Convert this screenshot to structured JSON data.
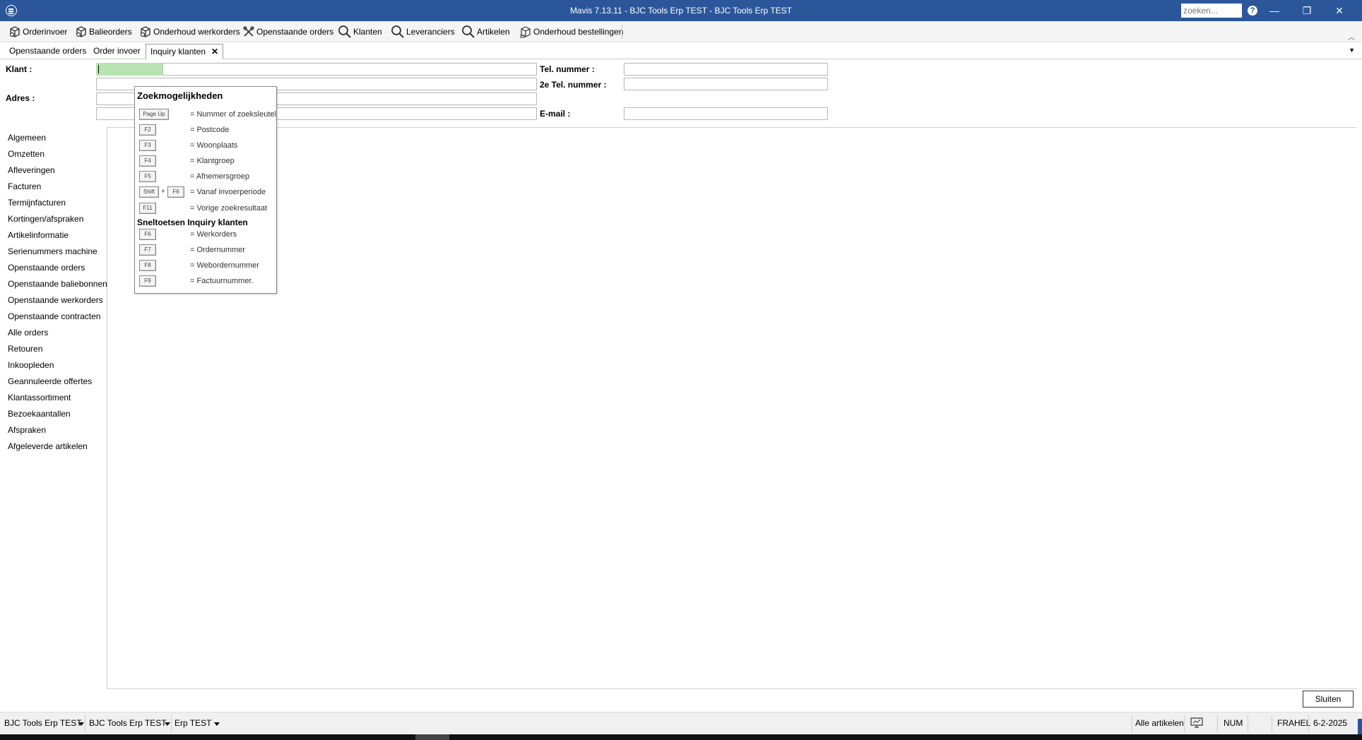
{
  "window": {
    "title": "Mavis 7.13.11 - BJC Tools Erp TEST - BJC Tools Erp TEST",
    "search_placeholder": "zoeken...",
    "help": "?",
    "minimize": "—",
    "restore": "❐",
    "close": "✕"
  },
  "toolbar": {
    "items": [
      {
        "label": "Orderinvoer",
        "icon": "order-entry-icon"
      },
      {
        "label": "Balieorders",
        "icon": "counter-orders-icon"
      },
      {
        "label": "Onderhoud werkorders",
        "icon": "work-orders-icon"
      },
      {
        "label": "Openstaande orders",
        "icon": "tools-icon"
      },
      {
        "label": "Klanten",
        "icon": "search-icon"
      },
      {
        "label": "Leveranciers",
        "icon": "search-icon"
      },
      {
        "label": "Artikelen",
        "icon": "search-icon"
      },
      {
        "label": "Onderhoud bestellingen",
        "icon": "purchase-orders-icon"
      }
    ]
  },
  "tabs": [
    {
      "label": "Openstaande orders"
    },
    {
      "label": "Order invoer"
    },
    {
      "label": "Inquiry klanten",
      "active": true,
      "close": "✕"
    }
  ],
  "form": {
    "klant_label": "Klant :",
    "adres_label": "Adres :",
    "tel_label": "Tel. nummer :",
    "tel2_label": "2e Tel. nummer :",
    "email_label": "E-mail :",
    "klant_value": "",
    "tel_value": "",
    "tel2_value": "",
    "email_value": ""
  },
  "nav": {
    "items": [
      "Algemeen",
      "Omzetten",
      "Afleveringen",
      "Facturen",
      "Termijnfacturen",
      "Kortingen/afspraken",
      "Artikelinformatie",
      "Serienummers machine",
      "Openstaande orders",
      "Openstaande baliebonnen",
      "Openstaande werkorders",
      "Openstaande contracten",
      "Alle orders",
      "Retouren",
      "Inkoopleden",
      "Geannuleerde offertes",
      "Klantassortiment",
      "Bezoekaantallen",
      "Afspraken",
      "Afgeleverde artikelen"
    ]
  },
  "popup": {
    "heading1": "Zoekmogelijkheden",
    "heading2": "Sneltoetsen Inquiry klanten",
    "search_keys": [
      {
        "keys": [
          "Page Up"
        ],
        "desc": "= Nummer of zoeksleutel"
      },
      {
        "keys": [
          "F2"
        ],
        "desc": "= Postcode"
      },
      {
        "keys": [
          "F3"
        ],
        "desc": "= Woonplaats"
      },
      {
        "keys": [
          "F4"
        ],
        "desc": "= Klantgroep"
      },
      {
        "keys": [
          "F5"
        ],
        "desc": "= Afnemersgroep"
      },
      {
        "keys": [
          "Shift",
          "F6"
        ],
        "desc": "= Vanaf invoerperiode",
        "plus": "+"
      },
      {
        "keys": [
          "F11"
        ],
        "desc": "= Vorige zoekresultaat"
      }
    ],
    "shortcut_keys": [
      {
        "keys": [
          "F6"
        ],
        "desc": "= Werkorders"
      },
      {
        "keys": [
          "F7"
        ],
        "desc": "= Ordernummer"
      },
      {
        "keys": [
          "F8"
        ],
        "desc": "= Webordernummer"
      },
      {
        "keys": [
          "F9"
        ],
        "desc": "= Factuurnummer."
      }
    ]
  },
  "buttons": {
    "sluiten": "Sluiten"
  },
  "statusbar": {
    "company1": "BJC Tools Erp TEST",
    "company2": "BJC Tools Erp TEST",
    "env": "Erp TEST",
    "articles": "Alle artikelen",
    "num": "NUM",
    "user": "FRAHEL",
    "date": "6-2-2025"
  },
  "colors": {
    "titlebar": "#2b579a",
    "active_field": "#b7e4b0"
  }
}
